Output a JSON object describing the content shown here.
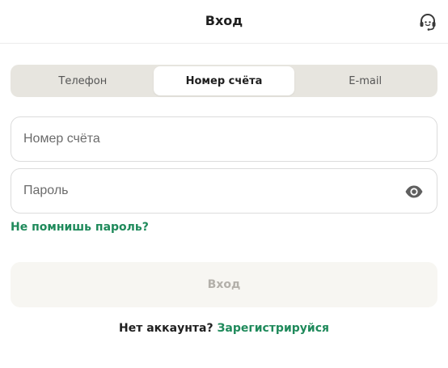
{
  "header": {
    "title": "Вход",
    "support_icon": "headset-icon"
  },
  "tabs": [
    {
      "label": "Телефон",
      "active": false
    },
    {
      "label": "Номер счёта",
      "active": true
    },
    {
      "label": "E-mail",
      "active": false
    }
  ],
  "form": {
    "account_placeholder": "Номер счёта",
    "account_value": "",
    "password_placeholder": "Пароль",
    "password_value": "",
    "password_toggle_icon": "eye-icon",
    "forgot_label": "Не помнишь пароль?",
    "submit_label": "Вход"
  },
  "footer": {
    "no_account_text": "Нет аккаунта?",
    "register_label": "Зарегистрируйся"
  },
  "colors": {
    "accent": "#1f8a5b",
    "tab_track": "#e7e5df",
    "submit_disabled_bg": "#f7f6f2",
    "submit_disabled_text": "#b3b0aa"
  }
}
